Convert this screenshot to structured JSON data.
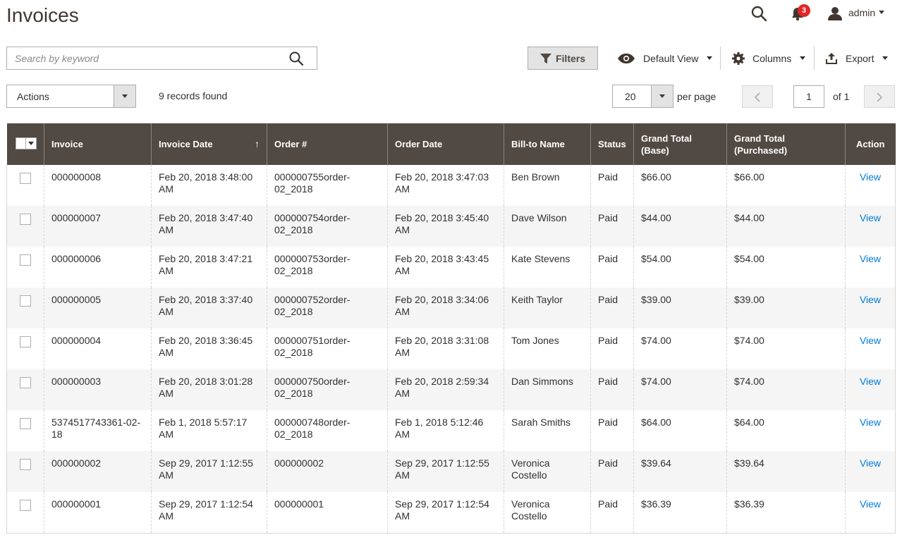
{
  "page": {
    "title": "Invoices"
  },
  "header": {
    "notification_count": "3",
    "user": "admin"
  },
  "search": {
    "placeholder": "Search by keyword",
    "value": ""
  },
  "toolbar": {
    "filters_label": "Filters",
    "view_label": "Default View",
    "columns_label": "Columns",
    "export_label": "Export",
    "actions_label": "Actions",
    "records_found": "9 records found",
    "per_page_value": "20",
    "per_page_label": "per page",
    "current_page": "1",
    "page_total": "of 1"
  },
  "table": {
    "columns": [
      "Invoice",
      "Invoice Date",
      "Order #",
      "Order Date",
      "Bill-to Name",
      "Status",
      "Grand Total (Base)",
      "Grand Total (Purchased)",
      "Action"
    ],
    "sort_indicator": "↑",
    "rows": [
      {
        "invoice": "000000008",
        "invoice_date": "Feb 20, 2018 3:48:00 AM",
        "order": "000000755order-02_2018",
        "order_date": "Feb 20, 2018 3:47:03 AM",
        "bill_to": "Ben Brown",
        "status": "Paid",
        "total_base": "$66.00",
        "total_purchased": "$66.00",
        "action": "View"
      },
      {
        "invoice": "000000007",
        "invoice_date": "Feb 20, 2018 3:47:40 AM",
        "order": "000000754order-02_2018",
        "order_date": "Feb 20, 2018 3:45:40 AM",
        "bill_to": "Dave Wilson",
        "status": "Paid",
        "total_base": "$44.00",
        "total_purchased": "$44.00",
        "action": "View"
      },
      {
        "invoice": "000000006",
        "invoice_date": "Feb 20, 2018 3:47:21 AM",
        "order": "000000753order-02_2018",
        "order_date": "Feb 20, 2018 3:43:45 AM",
        "bill_to": "Kate Stevens",
        "status": "Paid",
        "total_base": "$54.00",
        "total_purchased": "$54.00",
        "action": "View"
      },
      {
        "invoice": "000000005",
        "invoice_date": "Feb 20, 2018 3:37:40 AM",
        "order": "000000752order-02_2018",
        "order_date": "Feb 20, 2018 3:34:06 AM",
        "bill_to": "Keith Taylor",
        "status": "Paid",
        "total_base": "$39.00",
        "total_purchased": "$39.00",
        "action": "View"
      },
      {
        "invoice": "000000004",
        "invoice_date": "Feb 20, 2018 3:36:45 AM",
        "order": "000000751order-02_2018",
        "order_date": "Feb 20, 2018 3:31:08 AM",
        "bill_to": "Tom Jones",
        "status": "Paid",
        "total_base": "$74.00",
        "total_purchased": "$74.00",
        "action": "View"
      },
      {
        "invoice": "000000003",
        "invoice_date": "Feb 20, 2018 3:01:28 AM",
        "order": "000000750order-02_2018",
        "order_date": "Feb 20, 2018 2:59:34 AM",
        "bill_to": "Dan Simmons",
        "status": "Paid",
        "total_base": "$74.00",
        "total_purchased": "$74.00",
        "action": "View"
      },
      {
        "invoice": "5374517743361-02-18",
        "invoice_date": "Feb 1, 2018 5:57:17 AM",
        "order": "000000748order-02_2018",
        "order_date": "Feb 1, 2018 5:12:46 AM",
        "bill_to": "Sarah Smiths",
        "status": "Paid",
        "total_base": "$64.00",
        "total_purchased": "$64.00",
        "action": "View"
      },
      {
        "invoice": "000000002",
        "invoice_date": "Sep 29, 2017 1:12:55 AM",
        "order": "000000002",
        "order_date": "Sep 29, 2017 1:12:55 AM",
        "bill_to": "Veronica Costello",
        "status": "Paid",
        "total_base": "$39.64",
        "total_purchased": "$39.64",
        "action": "View"
      },
      {
        "invoice": "000000001",
        "invoice_date": "Sep 29, 2017 1:12:54 AM",
        "order": "000000001",
        "order_date": "Sep 29, 2017 1:12:54 AM",
        "bill_to": "Veronica Costello",
        "status": "Paid",
        "total_base": "$36.39",
        "total_purchased": "$36.39",
        "action": "View"
      }
    ]
  },
  "colors": {
    "header_bg": "#514943",
    "link": "#007bdb",
    "badge": "#e22626"
  }
}
